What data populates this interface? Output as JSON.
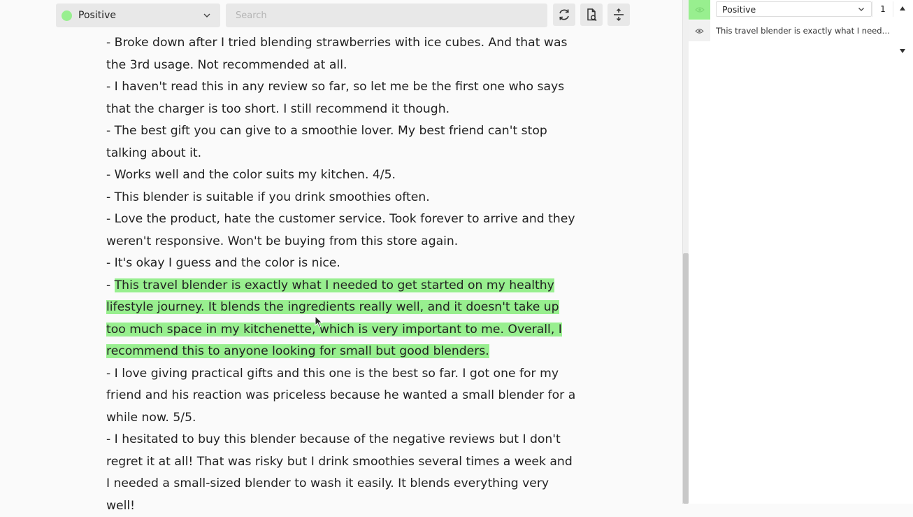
{
  "toolbar": {
    "label_select": {
      "value": "Positive",
      "color": "#98ef8f",
      "icon": "chevron-down-icon"
    },
    "search": {
      "placeholder": "Search",
      "value": ""
    },
    "buttons": [
      {
        "icon": "refresh-icon"
      },
      {
        "icon": "document-search-icon"
      },
      {
        "icon": "collapse-expand-icon"
      }
    ]
  },
  "document": {
    "paragraphs": [
      {
        "text": "- Broke down after I tried blending strawberries with ice cubes. And that was the 3rd usage. Not recommended at all.",
        "highlighted": false
      },
      {
        "text": "- I haven't read this in any review so far, so let me be the first one who says that the charger is too short. I still recommend it though.",
        "highlighted": false
      },
      {
        "text": "- The best gift you can give to a smoothie lover. My best friend can't stop talking about it.",
        "highlighted": false
      },
      {
        "text": "- Works well and the color suits my kitchen. 4/5.",
        "highlighted": false
      },
      {
        "text": "- This blender is suitable if you drink smoothies often.",
        "highlighted": false
      },
      {
        "text": "- Love the product, hate the customer service. Took forever to arrive and they weren't responsive. Won't be buying from this store again.",
        "highlighted": false
      },
      {
        "text": "- It's okay I guess and the color is nice.",
        "highlighted": false
      },
      {
        "prefix": "- ",
        "text": "This travel blender is exactly what I needed to get started on my healthy lifestyle journey. It blends the ingredients really well, and it doesn't take up too much space in my kitchenette, which is very important to me. Overall, I recommend this to anyone looking for small but good blenders.",
        "highlighted": true
      },
      {
        "text": "- I love giving practical gifts and this one is the best so far. I got one for my friend and his reaction was priceless because he wanted a small blender for a while now. 5/5.",
        "highlighted": false
      },
      {
        "text": "- I hesitated to buy this blender because of the negative reviews but I don't regret it at all! That was risky but I drink smoothies several times a week and I needed a small-sized blender to wash it easily. It blends everything very well!",
        "highlighted": false
      }
    ],
    "highlight_color": "#98ef8f"
  },
  "annotations_panel": {
    "group": {
      "label": "Positive",
      "count": "1",
      "color": "#98ef8f"
    },
    "items": [
      {
        "text": "This travel blender is exactly what I needed to get started on my healthy lifestyle journey.",
        "icon": "eye-icon"
      }
    ]
  }
}
